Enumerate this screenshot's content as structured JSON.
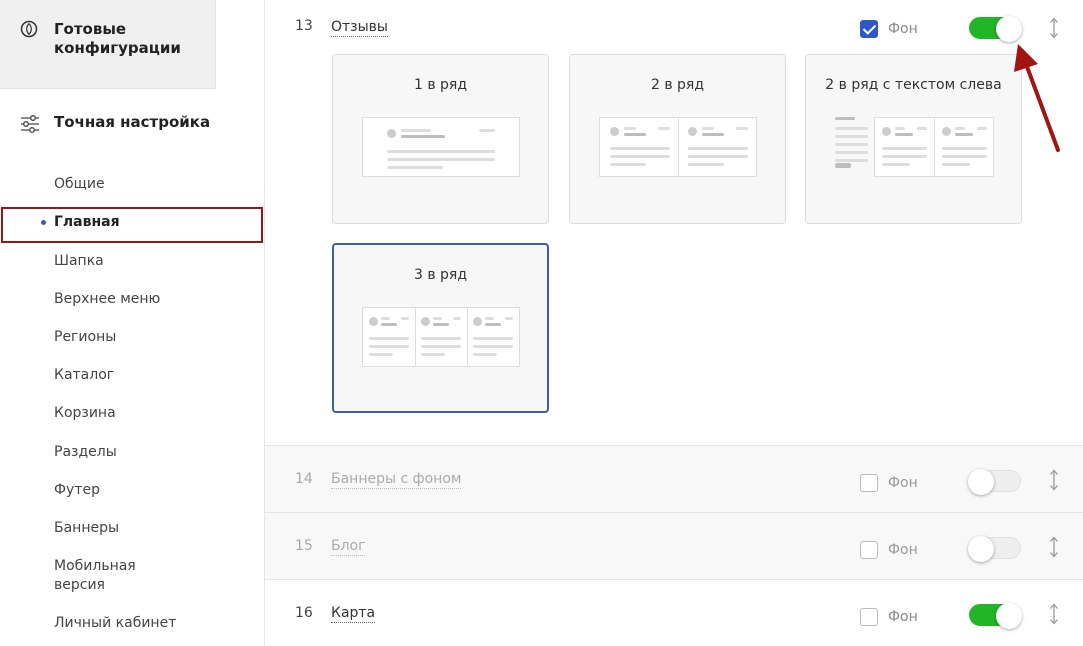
{
  "sidebar": {
    "ready": {
      "title": "Готовые конфигурации"
    },
    "tune": {
      "title": "Точная настройка"
    },
    "items": [
      {
        "label": "Общие",
        "active": false
      },
      {
        "label": "Главная",
        "active": true
      },
      {
        "label": "Шапка",
        "active": false
      },
      {
        "label": "Верхнее меню",
        "active": false
      },
      {
        "label": "Регионы",
        "active": false
      },
      {
        "label": "Каталог",
        "active": false
      },
      {
        "label": "Корзина",
        "active": false
      },
      {
        "label": "Разделы",
        "active": false
      },
      {
        "label": "Футер",
        "active": false
      },
      {
        "label": "Баннеры",
        "active": false
      },
      {
        "label": "Мобильная версия",
        "active": false
      },
      {
        "label": "Личный кабинет",
        "active": false
      }
    ]
  },
  "sections": [
    {
      "num": "13",
      "title": "Отзывы",
      "bg_label": "Фон",
      "bg_checked": true,
      "enabled": true,
      "cards": [
        {
          "label": "1 в ряд",
          "selected": false
        },
        {
          "label": "2 в ряд",
          "selected": false
        },
        {
          "label": "2 в ряд с текстом слева",
          "selected": false
        },
        {
          "label": "3 в ряд",
          "selected": true
        }
      ]
    },
    {
      "num": "14",
      "title": "Баннеры с фоном",
      "bg_label": "Фон",
      "bg_checked": false,
      "enabled": false
    },
    {
      "num": "15",
      "title": "Блог",
      "bg_label": "Фон",
      "bg_checked": false,
      "enabled": false
    },
    {
      "num": "16",
      "title": "Карта",
      "bg_label": "Фон",
      "bg_checked": false,
      "enabled": true
    }
  ],
  "colors": {
    "accent": "#2f57c8",
    "toggle_on": "#22b526",
    "selected_border": "#3d5fa8",
    "annotation": "#a31515"
  }
}
